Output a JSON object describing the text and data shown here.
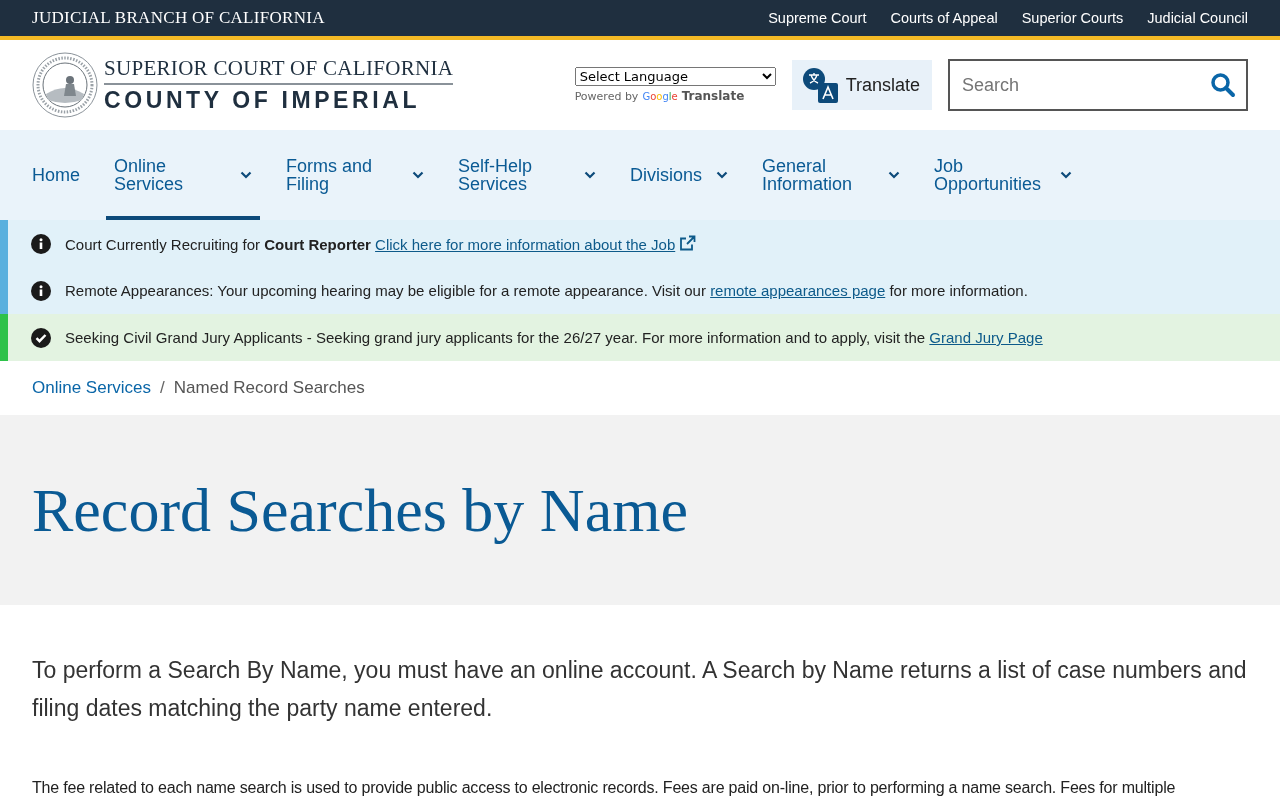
{
  "top_bar": {
    "title": "JUDICIAL BRANCH OF CALIFORNIA",
    "links": [
      "Supreme Court",
      "Courts of Appeal",
      "Superior Courts",
      "Judicial Council"
    ]
  },
  "header": {
    "logo_line_1": "SUPERIOR COURT OF CALIFORNIA",
    "logo_line_2": "COUNTY OF IMPERIAL",
    "language_select": "Select Language",
    "powered_by": "Powered by",
    "google": "Google",
    "google_translate": "Translate",
    "translate_button": "Translate",
    "search": {
      "placeholder": "Search"
    }
  },
  "nav": [
    {
      "label": "Home",
      "selected": false,
      "dropdown": false
    },
    {
      "label": "Online Services",
      "selected": true,
      "dropdown": true
    },
    {
      "label": "Forms and Filing",
      "selected": false,
      "dropdown": true
    },
    {
      "label": "Self-Help Services",
      "selected": false,
      "dropdown": true
    },
    {
      "label": "Divisions",
      "selected": false,
      "dropdown": true
    },
    {
      "label": "General Information",
      "selected": false,
      "dropdown": true
    },
    {
      "label": "Job Opportunities",
      "selected": false,
      "dropdown": true
    }
  ],
  "alerts": [
    {
      "kind": "info",
      "text": "Court Currently Recruiting for **Court Reporter**",
      "link": "Click here for more information about the Job",
      "external": true
    },
    {
      "kind": "info",
      "text": "Remote Appearances: Your upcoming hearing may be eligible for a remote appearance. Visit our",
      "link": "remote appearances page",
      "after": "for more information.",
      "external": false
    },
    {
      "kind": "success",
      "text": "Seeking Civil Grand Jury Applicants - Seeking grand jury applicants for the 26/27 year. For more information and to apply, visit the",
      "link": "Grand Jury Page",
      "external": false
    }
  ],
  "breadcrumb_separator": "/",
  "breadcrumb": [
    {
      "label": "Online Services",
      "link": true
    },
    {
      "label": "Named Record Searches",
      "link": false
    }
  ],
  "page_title": "Record Searches by Name",
  "intro": "To perform a Search By Name, you must have an online account. A Search by Name returns a list of case numbers and filing dates matching the party name entered.",
  "body_text": "The fee related to each name search is used to provide public access to electronic records. Fees are paid on-line, prior to performing a name search. Fees for multiple"
}
